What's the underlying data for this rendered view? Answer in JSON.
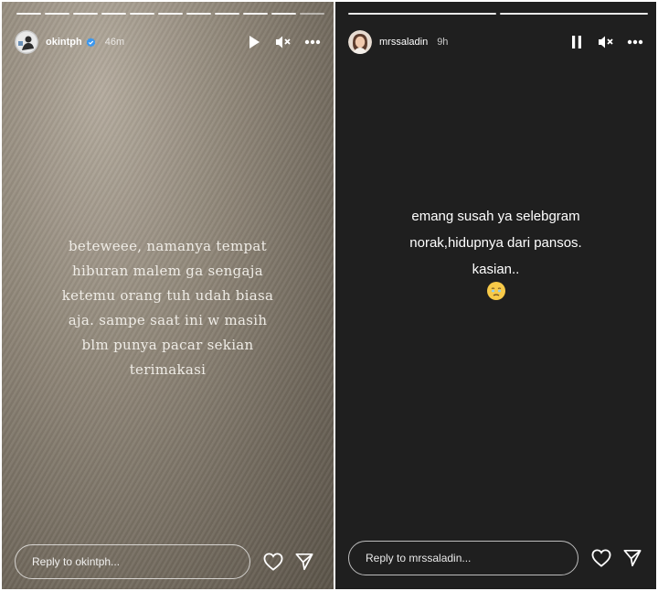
{
  "left_story": {
    "username": "okintph",
    "verified": true,
    "time_ago": "46m",
    "avatar_icon": "avatar-icon",
    "controls": [
      "play-icon",
      "muted-icon",
      "more-icon"
    ],
    "progress_segments": 11,
    "progress_active": 11,
    "text": "beteweee, namanya tempat\nhiburan malem ga sengaja\nketemu orang tuh udah biasa\naja. sampe saat ini w masih\nblm punya pacar sekian\nterimakasi",
    "reply_placeholder": "Reply to okintph...",
    "actions": [
      "heart-icon",
      "send-icon"
    ]
  },
  "right_story": {
    "username": "mrssaladin",
    "verified": false,
    "time_ago": "9h",
    "avatar_icon": "avatar-icon",
    "controls": [
      "pause-icon",
      "muted-icon",
      "more-icon"
    ],
    "progress_segments": 2,
    "progress_active": 2,
    "text": "emang susah ya selebgram\nnorak,hidupnya dari pansos.\nkasian..",
    "emoji": "face-holding-back-tears-icon",
    "reply_placeholder": "Reply to mrssaladin...",
    "actions": [
      "heart-icon",
      "send-icon"
    ]
  },
  "colors": {
    "right_background": "#1f1f1f",
    "text": "#ffffff",
    "verified_badge": "#3897f0",
    "emoji_yellow": "#f7c948"
  }
}
